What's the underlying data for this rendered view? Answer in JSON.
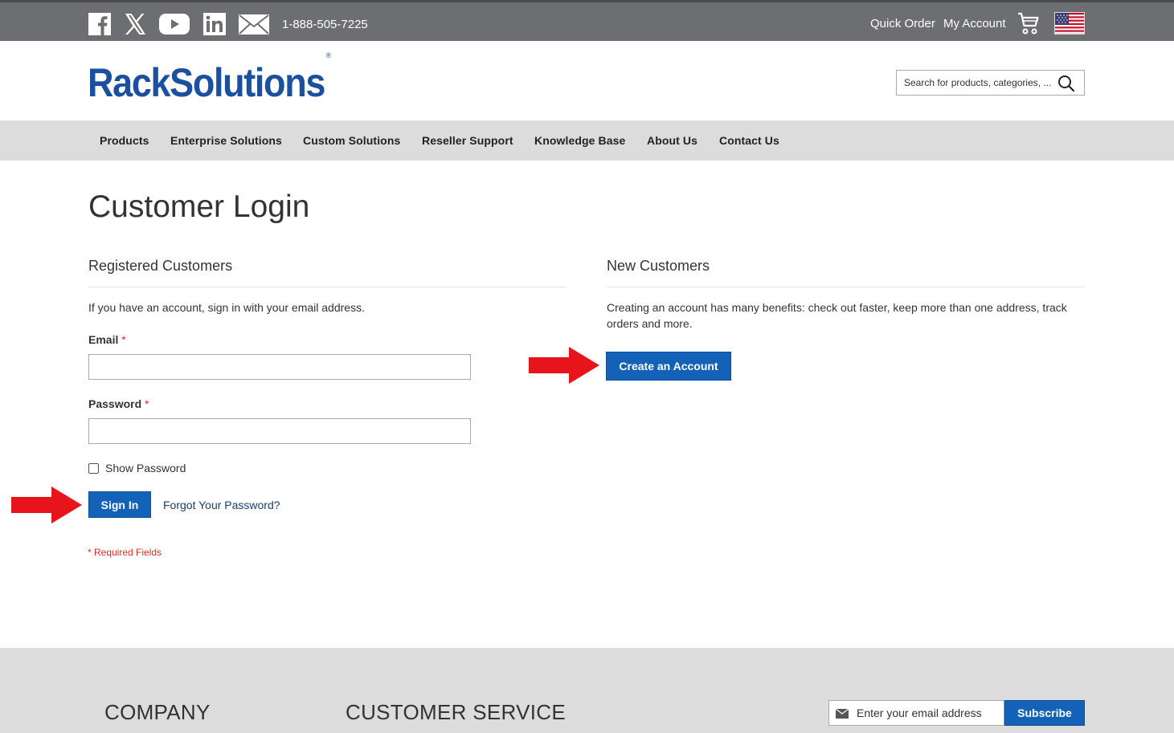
{
  "topbar": {
    "social_icons": [
      "facebook-icon",
      "x-icon",
      "youtube-icon",
      "linkedin-icon",
      "mail-icon"
    ],
    "phone": "1-888-505-7225",
    "quick_order": "Quick Order",
    "my_account": "My Account",
    "cart_icon": "cart-icon",
    "flag_icon": "us-flag-icon"
  },
  "header": {
    "logo_text": "RackSolutions",
    "logo_reg": "®",
    "search_placeholder": "Search for products, categories, ..."
  },
  "nav": {
    "items": [
      "Products",
      "Enterprise Solutions",
      "Custom Solutions",
      "Reseller Support",
      "Knowledge Base",
      "About Us",
      "Contact Us"
    ]
  },
  "page": {
    "title": "Customer Login",
    "registered": {
      "title": "Registered Customers",
      "intro": "If you have an account, sign in with your email address.",
      "email_label": "Email",
      "password_label": "Password",
      "required_mark": "*",
      "show_password": "Show Password",
      "sign_in": "Sign In",
      "forgot": "Forgot Your Password?",
      "required_note": "* Required Fields"
    },
    "new_customers": {
      "title": "New Customers",
      "intro": "Creating an account has many benefits: check out faster, keep more than one address, track orders and more.",
      "create_button": "Create an Account"
    }
  },
  "footer": {
    "company": "COMPANY",
    "customer_service": "CUSTOMER SERVICE",
    "newsletter_placeholder": "Enter your email address",
    "subscribe": "Subscribe"
  },
  "colors": {
    "topbar": "#6d6e71",
    "brand_blue": "#1b4fa0",
    "button_blue": "#1461b8",
    "nav_bg": "#dcdcdd",
    "annotation_arrow": "#e8141c",
    "required_red": "#e02b27"
  }
}
